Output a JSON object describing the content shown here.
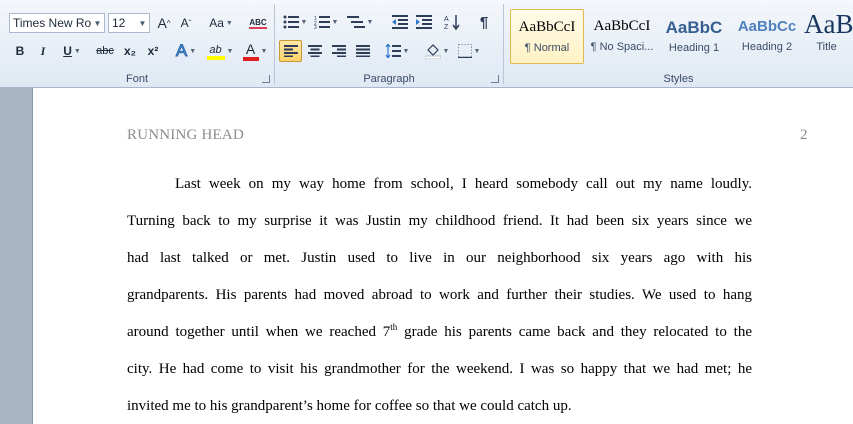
{
  "font_group": {
    "font_name": "Times New Rom",
    "font_size": "12",
    "grow_font": "A",
    "shrink_font": "A",
    "change_case": "Aa",
    "clear_formatting": "ABC",
    "bold": "B",
    "italic": "I",
    "underline": "U",
    "strikethrough": "abc",
    "subscript": "x₂",
    "superscript": "x²",
    "text_effects": "A",
    "highlight": "ab",
    "font_color": "A",
    "label": "Font"
  },
  "paragraph_group": {
    "label": "Paragraph"
  },
  "styles_group": {
    "label": "Styles",
    "tiles": [
      {
        "sample": "AaBbCcI",
        "name": "¶ Normal"
      },
      {
        "sample": "AaBbCcI",
        "name": "¶ No Spaci..."
      },
      {
        "sample": "AaBbC",
        "name": "Heading 1"
      },
      {
        "sample": "AaBbCc",
        "name": "Heading 2"
      },
      {
        "sample": "AaB",
        "name": "Title"
      }
    ]
  },
  "document": {
    "running_head": "RUNNING HEAD",
    "page_number": "2",
    "lines": [
      "Last week on my way home from school, I heard somebody call out my name loudly.",
      "Turning back to my surprise it was Justin my childhood friend. It had been six years since we",
      "had last talked or met. Justin used to live in our neighborhood six years ago with his",
      "grandparents. His parents had moved abroad to work and further their studies. We used to hang",
      "around together until when we reached 7",
      "th",
      " grade his parents came back and they relocated to the",
      "city. He had come to visit his grandmother for the weekend. I was so happy that we had met; he",
      "invited me to his grandparent’s home for coffee so that we could catch up."
    ]
  },
  "colors": {
    "highlight": "#ffff00",
    "font_color": "#e02020",
    "heading_blue": "#365f91"
  }
}
